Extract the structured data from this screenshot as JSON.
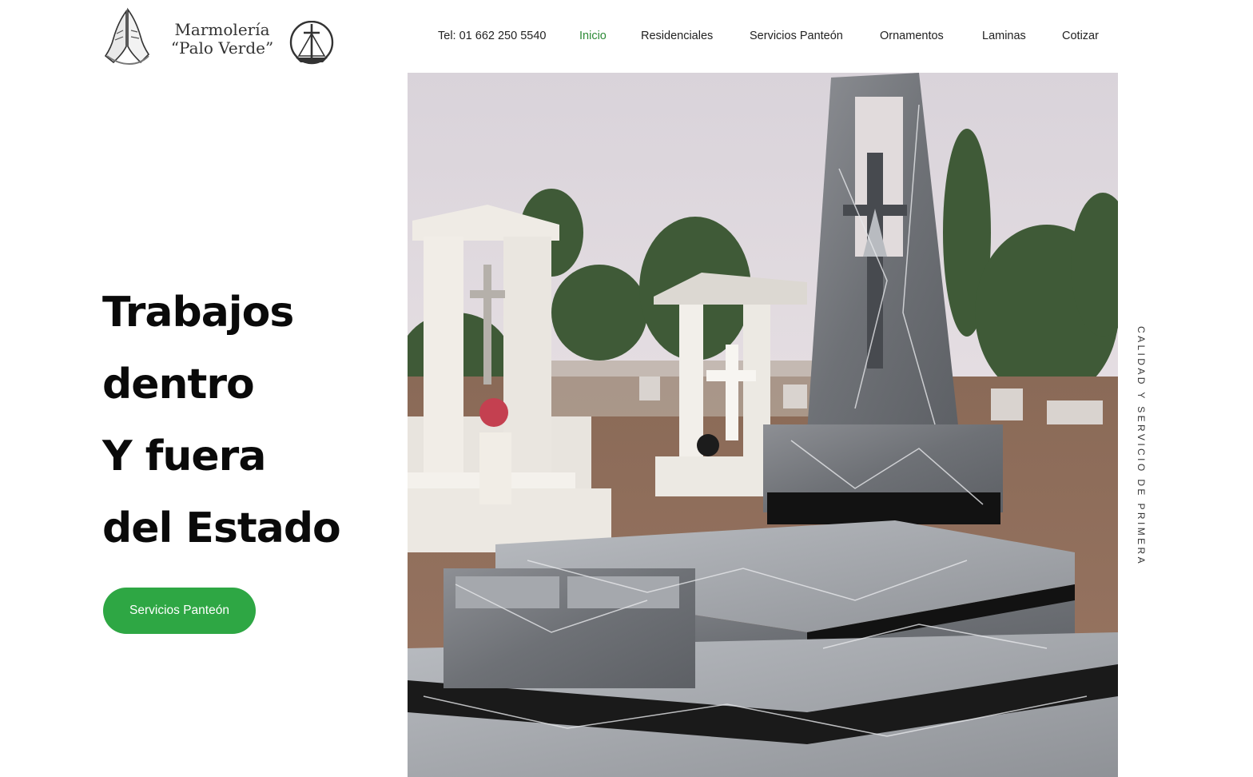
{
  "logo": {
    "line1": "Marmolería",
    "line2": "“Palo Verde”",
    "hands_icon": "praying-hands-icon",
    "emblem_icon": "cross-ship-emblem-icon"
  },
  "nav": {
    "phone": "Tel: 01 662 250 5540",
    "items": [
      {
        "label": "Inicio",
        "active": true
      },
      {
        "label": "Residenciales"
      },
      {
        "label": "Servicios Panteón"
      },
      {
        "label": "Ornamentos"
      },
      {
        "label": "Laminas"
      },
      {
        "label": "Cotizar"
      }
    ]
  },
  "hero": {
    "title_lines": [
      "Trabajos",
      "dentro",
      "Y fuera",
      "del Estado"
    ],
    "cta_label": "Servicios Panteón",
    "vertical_caption": "CALIDAD Y SERVICIO DE PRIMERA"
  },
  "colors": {
    "accent_green": "#2ea744",
    "active_nav": "#2d8a36",
    "title": "#0a0a0a"
  }
}
